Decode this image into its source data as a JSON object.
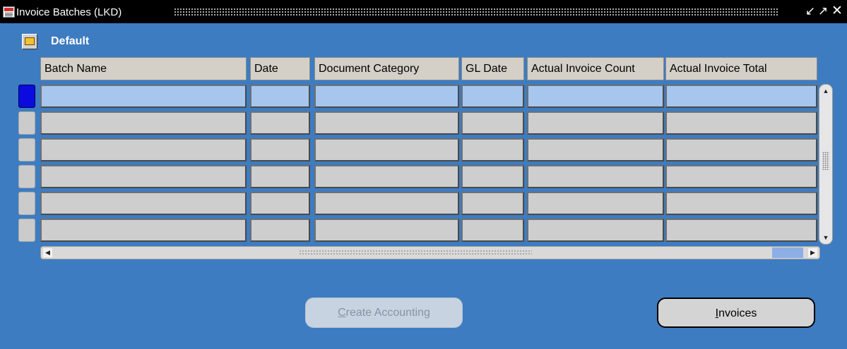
{
  "window": {
    "title": "Invoice Batches (LKD)",
    "app_icon": "oracle-forms-icon",
    "controls": [
      "minimize-icon",
      "maximize-icon",
      "close-icon"
    ]
  },
  "folder": {
    "icon": "folder-open-icon",
    "label": "Default"
  },
  "table": {
    "columns": [
      "Batch Name",
      "Date",
      "Document Category",
      "GL Date",
      "Actual Invoice Count",
      "Actual Invoice Total"
    ],
    "rows": [
      {
        "active": true,
        "cells": [
          "",
          "",
          "",
          "",
          "",
          ""
        ]
      },
      {
        "active": false,
        "cells": [
          "",
          "",
          "",
          "",
          "",
          ""
        ]
      },
      {
        "active": false,
        "cells": [
          "",
          "",
          "",
          "",
          "",
          ""
        ]
      },
      {
        "active": false,
        "cells": [
          "",
          "",
          "",
          "",
          "",
          ""
        ]
      },
      {
        "active": false,
        "cells": [
          "",
          "",
          "",
          "",
          "",
          ""
        ]
      },
      {
        "active": false,
        "cells": [
          "",
          "",
          "",
          "",
          "",
          ""
        ]
      }
    ]
  },
  "buttons": {
    "create_accounting": {
      "mnemonic": "C",
      "rest": "reate Accounting",
      "enabled": false
    },
    "invoices": {
      "mnemonic": "I",
      "rest": "nvoices",
      "enabled": true
    }
  },
  "colors": {
    "background": "#3d7cc1",
    "active_row": "#a7c6ee",
    "active_indicator": "#0b0bdf"
  }
}
